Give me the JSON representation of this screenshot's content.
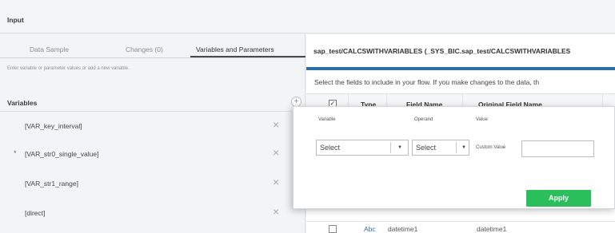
{
  "header": {
    "title": "Input"
  },
  "tabs": [
    {
      "label": "Data Sample"
    },
    {
      "label": "Changes (0)"
    },
    {
      "label": "Variables and Parameters",
      "active": true
    }
  ],
  "hint": "Enter variable or parameter values or add a new variable.",
  "variables": {
    "title": "Variables",
    "add_icon": "plus-circle-icon",
    "items": [
      {
        "name": "[VAR_key_interval]",
        "required": false
      },
      {
        "name": "[VAR_str0_single_value]",
        "required": true,
        "marker": "*"
      },
      {
        "name": "[VAR_str1_range]",
        "required": false
      },
      {
        "name": "[direct]",
        "required": false
      }
    ],
    "remove_icon": "close-icon"
  },
  "right_panel": {
    "heading": "sap_test/CALCSWITHVARIABLES (_SYS_BIC.sap_test/CALCSWITHVARIABLES",
    "subtitle": "Select the fields to include in your flow. If you make changes to the data, th",
    "columns": [
      "Type",
      "Field Name",
      "Original Field Name"
    ],
    "partial_row": {
      "type": "Abc",
      "field": "datetime1",
      "original": "datetime1"
    },
    "accent": "#2a6fa8"
  },
  "popup": {
    "variable_label": "Variable",
    "variable_value": "Select",
    "operand_label": "Operand",
    "operand_value": "Select",
    "value_label": "Value",
    "custom_value_label": "Custom Value",
    "custom_value": "",
    "apply_label": "Apply",
    "apply_color": "#2bbf5b"
  }
}
